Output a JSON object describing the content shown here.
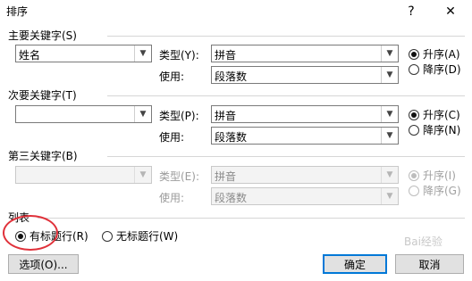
{
  "dialog": {
    "title": "排序",
    "help": "?",
    "close": "✕"
  },
  "primary": {
    "section": "主要关键字(S)",
    "field": "姓名",
    "type_label": "类型(Y):",
    "type_value": "拼音",
    "use_label": "使用:",
    "use_value": "段落数",
    "asc": "升序(A)",
    "desc": "降序(D)"
  },
  "secondary": {
    "section": "次要关键字(T)",
    "field": "",
    "type_label": "类型(P):",
    "type_value": "拼音",
    "use_label": "使用:",
    "use_value": "段落数",
    "asc": "升序(C)",
    "desc": "降序(N)"
  },
  "tertiary": {
    "section": "第三关键字(B)",
    "field": "",
    "type_label": "类型(E):",
    "type_value": "拼音",
    "use_label": "使用:",
    "use_value": "段落数",
    "asc": "升序(I)",
    "desc": "降序(G)"
  },
  "list": {
    "section": "列表",
    "header_yes": "有标题行(R)",
    "header_no": "无标题行(W)"
  },
  "buttons": {
    "options": "选项(O)...",
    "ok": "确定",
    "cancel": "取消"
  },
  "watermark": "Bai经验"
}
